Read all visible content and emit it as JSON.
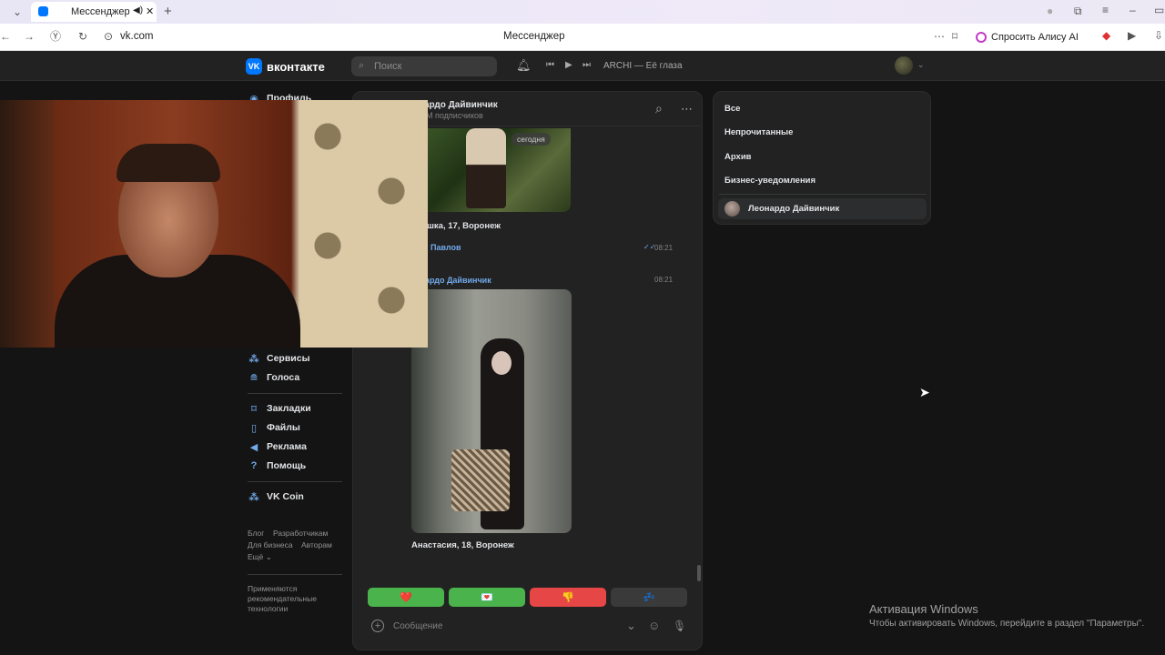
{
  "browser": {
    "tab_title": "Мессенджер",
    "url": "vk.com",
    "page_title": "Мессенджер",
    "alice_label": "Спросить Алису AI"
  },
  "header": {
    "logo": "вконтакте",
    "search_placeholder": "Поиск",
    "now_playing": "ARCHI — Её глаза"
  },
  "menu": {
    "items": [
      {
        "label": "Профиль",
        "icon": "profile-icon"
      },
      {
        "label": "Сервисы",
        "icon": "services-icon"
      },
      {
        "label": "Голоса",
        "icon": "votes-icon"
      },
      {
        "label": "Закладки",
        "icon": "bookmark-icon"
      },
      {
        "label": "Файлы",
        "icon": "file-icon"
      },
      {
        "label": "Реклама",
        "icon": "megaphone-icon"
      },
      {
        "label": "Помощь",
        "icon": "help-icon"
      },
      {
        "label": "VK Coin",
        "icon": "coin-icon"
      }
    ],
    "footer": {
      "blog": "Блог",
      "devs": "Разработчикам",
      "business": "Для бизнеса",
      "authors": "Авторам",
      "more": "Ещё ⌄",
      "recommend": "Применяются рекомендательные технологии"
    }
  },
  "chat": {
    "title": "Леонардо Дайвинчик",
    "title_partial": "ардо Дайвинчик",
    "subscribers": "M подписчиков",
    "date_badge": "сегодня",
    "messages": [
      {
        "caption": "шка, 17, Воронеж"
      },
      {
        "sender": "Павлов",
        "time": "08:21"
      },
      {
        "sender": "ардо Дайвинчик",
        "time": "08:21",
        "caption": "Анастасия, 18, Воронеж"
      }
    ],
    "keyboard": [
      {
        "emoji": "❤️",
        "color": "#4bb34b"
      },
      {
        "emoji": "💌",
        "color": "#4bb34b"
      },
      {
        "emoji": "👎",
        "color": "#e64646"
      },
      {
        "emoji": "💤",
        "color": "#3a3a3b"
      }
    ],
    "composer_placeholder": "Сообщение"
  },
  "folders": {
    "items": [
      "Все",
      "Непрочитанные",
      "Архив",
      "Бизнес-уведомления"
    ],
    "pinned": "Леонардо Дайвинчик"
  },
  "windows": {
    "title": "Активация Windows",
    "subtitle": "Чтобы активировать Windows, перейдите в раздел \"Параметры\"."
  }
}
